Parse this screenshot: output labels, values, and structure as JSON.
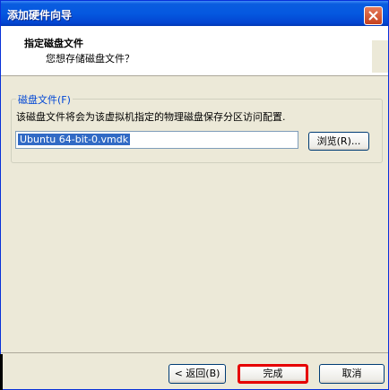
{
  "window": {
    "title": "添加硬件向导"
  },
  "header": {
    "title": "指定磁盘文件",
    "subtitle": "您想存储磁盘文件？"
  },
  "group": {
    "legend": "磁盘文件(F)",
    "description": "该磁盘文件将会为该虚拟机指定的物理磁盘保存分区访问配置.",
    "file_value": "Ubuntu 64-bit-0.vmdk",
    "browse_label": "浏览(R)..."
  },
  "buttons": {
    "back": "< 返回(B)",
    "finish": "完成",
    "cancel": "取消"
  },
  "colors": {
    "title_bar": "#0558e0",
    "highlight": "#e60000",
    "selection": "#316ac5"
  },
  "icons": {
    "close": "close-icon"
  }
}
